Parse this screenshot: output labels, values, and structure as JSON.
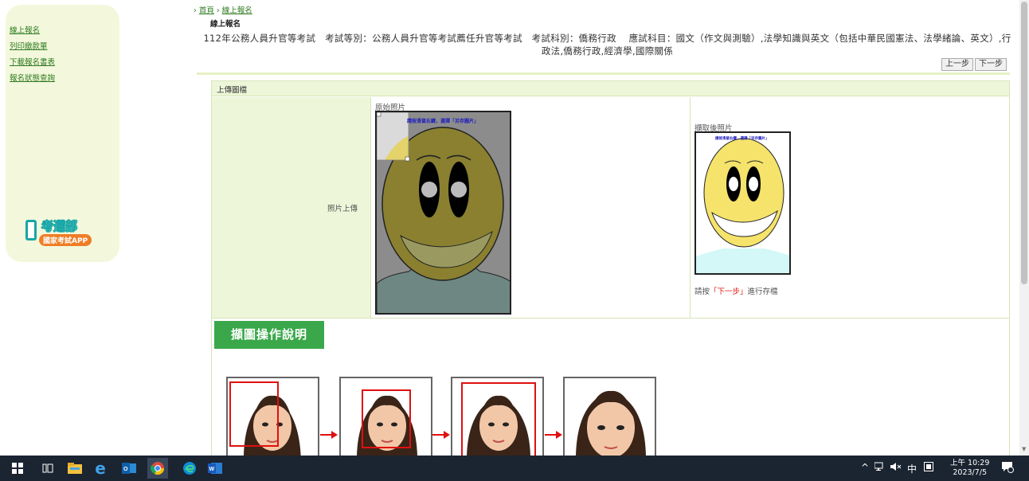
{
  "sidebar": {
    "links": [
      {
        "label": "線上報名"
      },
      {
        "label": "列印繳款單"
      },
      {
        "label": "下載報名書表"
      },
      {
        "label": "報名狀態查詢"
      }
    ],
    "app": {
      "title": "考選部",
      "subtitle": "國家考試APP"
    }
  },
  "breadcrumb": {
    "home": "首頁",
    "current": "線上報名"
  },
  "page_title": "線上報名",
  "exam_info": "112年公務人員升官等考試　考試等別：公務人員升官等考試薦任升官等考試　考試科別：僑務行政　 應試科目：國文（作文與測驗）,法學知識與英文（包括中華民國憲法、法學緒論、英文）,行政法,僑務行政,經濟學,國際關係",
  "nav": {
    "prev": "上一步",
    "next": "下一步"
  },
  "panel": {
    "header": "上傳圖檔",
    "field_label": "照片上傳",
    "original_caption": "原始照片",
    "cropped_caption": "擷取後照片",
    "photo_banner": "請按滑鼠右鍵，選擇「另存圖片」",
    "hint_prefix": "請按",
    "hint_highlight": "「下一步」",
    "hint_suffix": "進行存檔"
  },
  "help_button": "擷圖操作說明",
  "taskbar": {
    "icons": [
      "windows-start-icon",
      "task-view-icon",
      "file-explorer-icon",
      "internet-explorer-icon",
      "outlook-icon",
      "chrome-icon",
      "edge-icon",
      "word-icon"
    ],
    "tray": {
      "chevron": "^",
      "ime": "中"
    },
    "time": "上午 10:29",
    "date": "2023/7/5"
  },
  "colors": {
    "accent_green": "#3aa84a",
    "sidebar_bg": "#f3f8dc",
    "link": "#2d7a1e",
    "taskbar": "#1b2431"
  }
}
